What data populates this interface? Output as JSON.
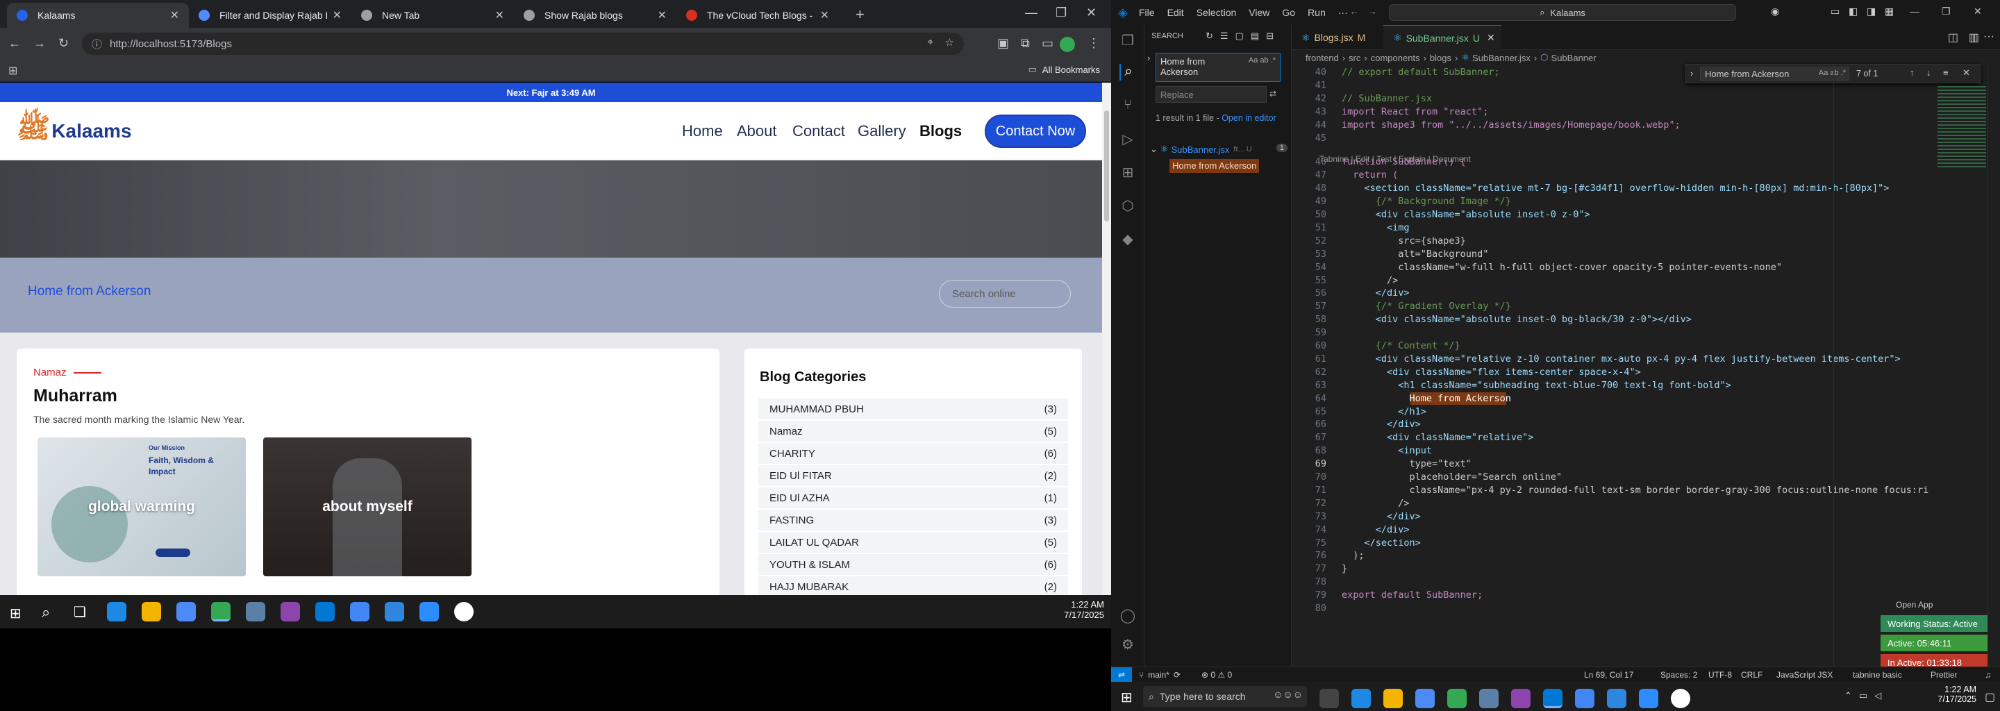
{
  "browser": {
    "tabs": [
      {
        "title": "Kalaams",
        "active": true,
        "color": "#2563eb"
      },
      {
        "title": "Filter and Display Rajab Blog Ir",
        "active": false,
        "color": "#4f8cff"
      },
      {
        "title": "New Tab",
        "active": false,
        "color": "#9aa0a6"
      },
      {
        "title": "Show Rajab blogs",
        "active": false,
        "color": "#9aa0a6"
      },
      {
        "title": "The vCloud Tech Blogs - vClou",
        "active": false,
        "color": "#d93025"
      }
    ],
    "url": "http://localhost:5173/Blogs",
    "bookmarks_label": "All Bookmarks"
  },
  "site": {
    "topbar": "Next: Fajr at 3:49 AM",
    "logo_text": "Kalaams",
    "nav": [
      "Home",
      "About",
      "Contact",
      "Gallery",
      "Blogs"
    ],
    "contact_label": "Contact Now",
    "subbanner_title": "Home from Ackerson",
    "search_placeholder": "Search online",
    "post": {
      "tag": "Namaz",
      "title": "Muharram",
      "description": "The sacred month marking the Islamic New Year.",
      "cards": [
        "global warming",
        "about myself"
      ],
      "card1_small": [
        "Our Mission",
        "Faith, Wisdom &",
        "Impact"
      ]
    },
    "categories_title": "Blog Categories",
    "categories": [
      {
        "name": "MUHAMMAD PBUH",
        "count": "(3)"
      },
      {
        "name": "Namaz",
        "count": "(5)"
      },
      {
        "name": "CHARITY",
        "count": "(6)"
      },
      {
        "name": "EID Ul FITAR",
        "count": "(2)"
      },
      {
        "name": "EID Ul AZHA",
        "count": "(1)"
      },
      {
        "name": "FASTING",
        "count": "(3)"
      },
      {
        "name": "LAILAT UL QADAR",
        "count": "(5)"
      },
      {
        "name": "YOUTH & ISLAM",
        "count": "(6)"
      },
      {
        "name": "HAJJ MUBARAK",
        "count": "(2)"
      }
    ]
  },
  "taskbar_left": {
    "time": "1:22 AM",
    "date": "7/17/2025"
  },
  "vscode": {
    "menu": [
      "File",
      "Edit",
      "Selection",
      "View",
      "Go",
      "Run"
    ],
    "search_title": "Kalaams",
    "side": {
      "header": "SEARCH",
      "search_value": "Home from Ackerson",
      "replace_placeholder": "Replace",
      "results_text": "1 result in 1 file -",
      "open_in_editor": "Open in editor",
      "file_name": "SubBanner.jsx",
      "file_path": "fr... U",
      "result_count": "1",
      "match": "Home from Ackerson"
    },
    "tabs": [
      {
        "name": "Blogs.jsx",
        "flag": "M",
        "active": false
      },
      {
        "name": "SubBanner.jsx",
        "flag": "U",
        "active": true
      }
    ],
    "breadcrumb": [
      "frontend",
      "src",
      "components",
      "blogs",
      "SubBanner.jsx",
      "SubBanner"
    ],
    "find": {
      "value": "Home from Ackerson",
      "count": "7 of 1"
    },
    "codelens": "Tabnine | Edit | Test | Explain | Document",
    "code": [
      {
        "n": "40",
        "t": "// export default SubBanner;"
      },
      {
        "n": "41",
        "t": ""
      },
      {
        "n": "42",
        "t": "// SubBanner.jsx"
      },
      {
        "n": "43",
        "t": "import React from \"react\";"
      },
      {
        "n": "44",
        "t": "import shape3 from \"../../assets/images/Homepage/book.webp\";"
      },
      {
        "n": "45",
        "t": ""
      },
      {
        "n": "46",
        "t": "function SubBanner() {"
      },
      {
        "n": "47",
        "t": "  return ("
      },
      {
        "n": "48",
        "t": "    <section className=\"relative mt-7 bg-[#c3d4f1] overflow-hidden min-h-[80px] md:min-h-[80px]\">"
      },
      {
        "n": "49",
        "t": "      {/* Background Image */}"
      },
      {
        "n": "50",
        "t": "      <div className=\"absolute inset-0 z-0\">"
      },
      {
        "n": "51",
        "t": "        <img"
      },
      {
        "n": "52",
        "t": "          src={shape3}"
      },
      {
        "n": "53",
        "t": "          alt=\"Background\""
      },
      {
        "n": "54",
        "t": "          className=\"w-full h-full object-cover opacity-5 pointer-events-none\""
      },
      {
        "n": "55",
        "t": "        />"
      },
      {
        "n": "56",
        "t": "      </div>"
      },
      {
        "n": "57",
        "t": "      {/* Gradient Overlay */}"
      },
      {
        "n": "58",
        "t": "      <div className=\"absolute inset-0 bg-black/30 z-0\"></div>"
      },
      {
        "n": "59",
        "t": ""
      },
      {
        "n": "60",
        "t": "      {/* Content */}"
      },
      {
        "n": "61",
        "t": "      <div className=\"relative z-10 container mx-auto px-4 py-4 flex justify-between items-center\">"
      },
      {
        "n": "62",
        "t": "        <div className=\"flex items-center space-x-4\">"
      },
      {
        "n": "63",
        "t": "          <h1 className=\"subheading text-blue-700 text-lg font-bold\">"
      },
      {
        "n": "64",
        "t": "            Home from Ackerson"
      },
      {
        "n": "65",
        "t": "          </h1>"
      },
      {
        "n": "66",
        "t": "        </div>"
      },
      {
        "n": "67",
        "t": "        <div className=\"relative\">"
      },
      {
        "n": "68",
        "t": "          <input"
      },
      {
        "n": "69",
        "t": "            type=\"text\""
      },
      {
        "n": "70",
        "t": "            placeholder=\"Search online\""
      },
      {
        "n": "71",
        "t": "            className=\"px-4 py-2 rounded-full text-sm border border-gray-300 focus:outline-none focus:ri"
      },
      {
        "n": "72",
        "t": "          />"
      },
      {
        "n": "73",
        "t": "        </div>"
      },
      {
        "n": "74",
        "t": "      </div>"
      },
      {
        "n": "75",
        "t": "    </section>"
      },
      {
        "n": "76",
        "t": "  );"
      },
      {
        "n": "77",
        "t": "}"
      },
      {
        "n": "78",
        "t": ""
      },
      {
        "n": "79",
        "t": "export default SubBanner;"
      },
      {
        "n": "80",
        "t": ""
      }
    ],
    "status": {
      "branch": "main*",
      "problems": "⊗ 0 ⚠ 0",
      "cursor": "Ln 69, Col 17",
      "spaces": "Spaces: 2",
      "encoding": "UTF-8",
      "eol": "CRLF",
      "language": "JavaScript JSX",
      "tabnine": "tabnine basic",
      "prettier": "Prettier"
    },
    "badges": {
      "open_app": "Open App",
      "working": "Working Status: Active",
      "active": "Active: 05:46:11",
      "inactive": "In Active: 01:33:18"
    }
  },
  "taskbar_right": {
    "search_placeholder": "Type here to search",
    "time": "1:22 AM",
    "date": "7/17/2025"
  }
}
